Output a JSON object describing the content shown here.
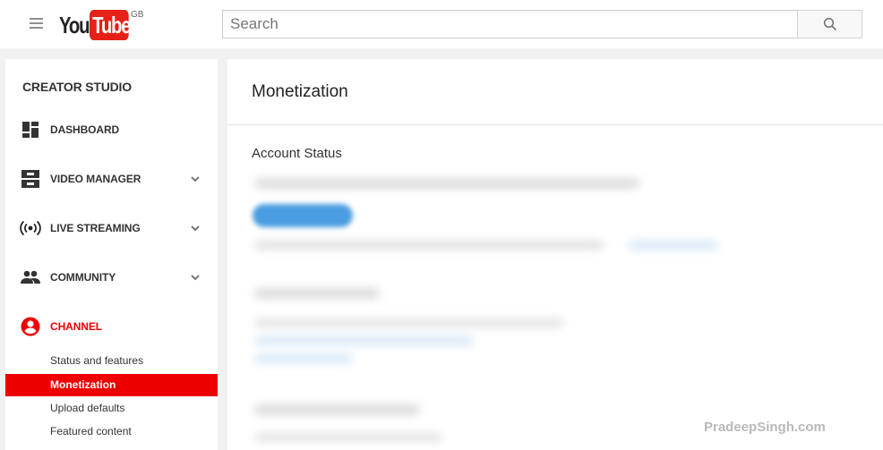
{
  "header": {
    "menu_icon": "hamburger-menu-icon",
    "logo_you": "You",
    "logo_tube": "Tube",
    "region": "GB",
    "search_placeholder": "Search",
    "search_icon": "search-icon"
  },
  "sidebar": {
    "title": "CREATOR STUDIO",
    "items": [
      {
        "label": "DASHBOARD",
        "icon": "dashboard-icon",
        "expandable": false
      },
      {
        "label": "VIDEO MANAGER",
        "icon": "video-manager-icon",
        "expandable": true
      },
      {
        "label": "LIVE STREAMING",
        "icon": "live-streaming-icon",
        "expandable": true
      },
      {
        "label": "COMMUNITY",
        "icon": "community-icon",
        "expandable": true
      },
      {
        "label": "CHANNEL",
        "icon": "channel-icon",
        "expandable": false,
        "active": true
      }
    ],
    "channel_subitems": [
      {
        "label": "Status and features"
      },
      {
        "label": "Monetization",
        "active": true
      },
      {
        "label": "Upload defaults"
      },
      {
        "label": "Featured content"
      }
    ]
  },
  "main": {
    "page_title": "Monetization",
    "section_title": "Account Status"
  },
  "watermark": "PradeepSingh.com",
  "colors": {
    "accent_red": "#ee0000",
    "link_blue": "#4a9de0",
    "background": "#f1f1f1"
  }
}
